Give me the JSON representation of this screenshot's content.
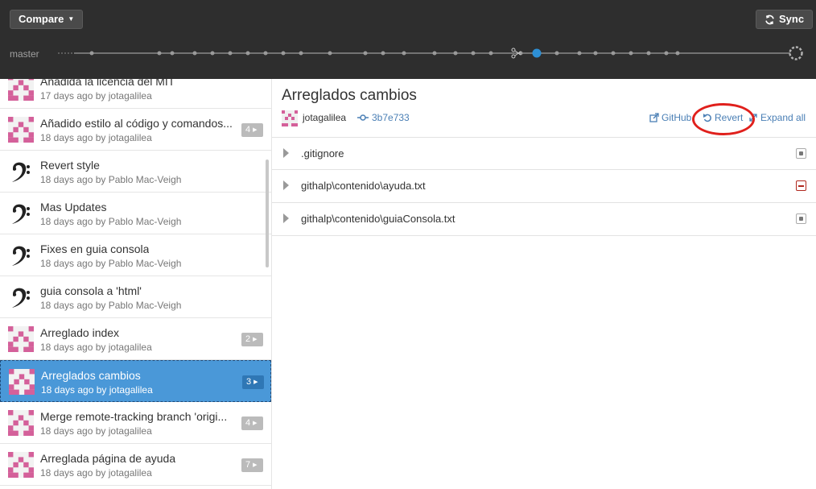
{
  "toolbar": {
    "compare_label": "Compare",
    "sync_label": "Sync",
    "branch": "master"
  },
  "commits": [
    {
      "title": "Añadida la licencia del MIT",
      "meta": "17 days ago by jotagalilea",
      "count": "",
      "avatar": "identicon"
    },
    {
      "title": "Añadido estilo al código y comandos...",
      "meta": "18 days ago by jotagalilea",
      "count": "4",
      "avatar": "identicon"
    },
    {
      "title": "Revert style",
      "meta": "18 days ago by Pablo Mac-Veigh",
      "count": "",
      "avatar": "bass-clef"
    },
    {
      "title": "Mas Updates",
      "meta": "18 days ago by Pablo Mac-Veigh",
      "count": "",
      "avatar": "bass-clef"
    },
    {
      "title": "Fixes en guia consola",
      "meta": "18 days ago by Pablo Mac-Veigh",
      "count": "",
      "avatar": "bass-clef"
    },
    {
      "title": "guia consola a 'html'",
      "meta": "18 days ago by Pablo Mac-Veigh",
      "count": "",
      "avatar": "bass-clef"
    },
    {
      "title": "Arreglado index",
      "meta": "18 days ago by jotagalilea",
      "count": "2",
      "avatar": "identicon"
    },
    {
      "title": "Arreglados cambios",
      "meta": "18 days ago by jotagalilea",
      "count": "3",
      "avatar": "identicon"
    },
    {
      "title": "Merge remote-tracking branch 'origi...",
      "meta": "18 days ago by jotagalilea",
      "count": "4",
      "avatar": "identicon"
    },
    {
      "title": "Arreglada página de ayuda",
      "meta": "18 days ago by jotagalilea",
      "count": "7",
      "avatar": "identicon"
    }
  ],
  "detail": {
    "title": "Arreglados cambios",
    "author": "jotagalilea",
    "sha": "3b7e733",
    "github_label": "GitHub",
    "revert_label": "Revert",
    "expand_label": "Expand all",
    "files": [
      {
        "name": ".gitignore",
        "status": "modified"
      },
      {
        "name": "githalp\\contenido\\ayuda.txt",
        "status": "deleted"
      },
      {
        "name": "githalp\\contenido\\guiaConsola.txt",
        "status": "modified"
      }
    ]
  },
  "colors": {
    "topbar": "#2e2e2e",
    "selected": "#4a98d8",
    "link": "#4a7fb5",
    "highlight_circle": "#e0201c",
    "identicon": "#d4609a"
  }
}
